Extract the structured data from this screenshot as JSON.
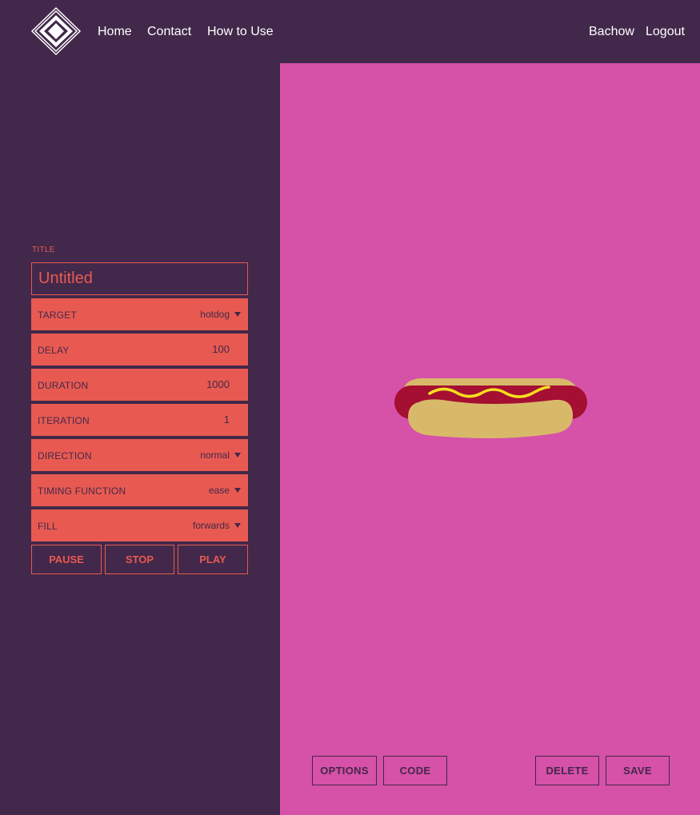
{
  "nav": {
    "links": [
      "Home",
      "Contact",
      "How to Use"
    ],
    "user": "Bachow",
    "logout": "Logout"
  },
  "editor": {
    "title_label": "TITLE",
    "title_value": "Untitled",
    "fields": {
      "target": {
        "label": "TARGET",
        "value": "hotdog"
      },
      "delay": {
        "label": "DELAY",
        "value": "100"
      },
      "duration": {
        "label": "DURATION",
        "value": "1000"
      },
      "iteration": {
        "label": "ITERATION",
        "value": "1"
      },
      "direction": {
        "label": "DIRECTION",
        "value": "normal"
      },
      "timing": {
        "label": "TIMING FUNCTION",
        "value": "ease"
      },
      "fill": {
        "label": "FILL",
        "value": "forwards"
      }
    },
    "controls": {
      "pause": "PAUSE",
      "stop": "STOP",
      "play": "PLAY"
    }
  },
  "stage": {
    "target_icon": "hotdog-icon",
    "actions": {
      "options": "OPTIONS",
      "code": "CODE",
      "delete": "DELETE",
      "save": "SAVE"
    }
  },
  "colors": {
    "sidebar_bg": "#42284a",
    "stage_bg": "#d651a8",
    "accent": "#e85a51",
    "bun": "#d8b96a",
    "sausage": "#a40f32",
    "mustard": "#f7e01f"
  }
}
